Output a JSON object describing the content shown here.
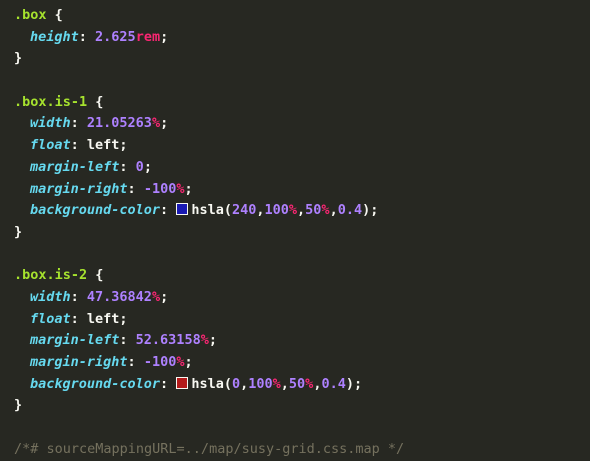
{
  "rules": [
    {
      "selector": ".box",
      "open": " {",
      "close": "}",
      "decls": [
        {
          "prop": "height",
          "value": "2.625",
          "unit": "rem"
        }
      ]
    },
    {
      "selector": ".box.is-1",
      "open": " {",
      "close": "}",
      "decls": [
        {
          "prop": "width",
          "value": "21.05263",
          "unit": "%"
        },
        {
          "prop": "float",
          "ident": "left"
        },
        {
          "prop": "margin-left",
          "value": "0",
          "unit": ""
        },
        {
          "prop": "margin-right",
          "value": "-100",
          "unit": "%"
        },
        {
          "prop": "background-color",
          "fn": "hsla",
          "args": [
            "240",
            "100",
            "50",
            "0.4"
          ],
          "swatch": "#1a1ab3"
        }
      ]
    },
    {
      "selector": ".box.is-2",
      "open": " {",
      "close": "}",
      "decls": [
        {
          "prop": "width",
          "value": "47.36842",
          "unit": "%"
        },
        {
          "prop": "float",
          "ident": "left"
        },
        {
          "prop": "margin-left",
          "value": "52.63158",
          "unit": "%"
        },
        {
          "prop": "margin-right",
          "value": "-100",
          "unit": "%"
        },
        {
          "prop": "background-color",
          "fn": "hsla",
          "args": [
            "0",
            "100",
            "50",
            "0.4"
          ],
          "swatch": "#b31a1a"
        }
      ]
    }
  ],
  "comment": "/*# sourceMappingURL=../map/susy-grid.css.map */",
  "colors": {
    "background": "#272822",
    "selector": "#a6e22e",
    "property": "#66d9ef",
    "number": "#ae81ff",
    "unit": "#f92672",
    "comment": "#75715e"
  }
}
